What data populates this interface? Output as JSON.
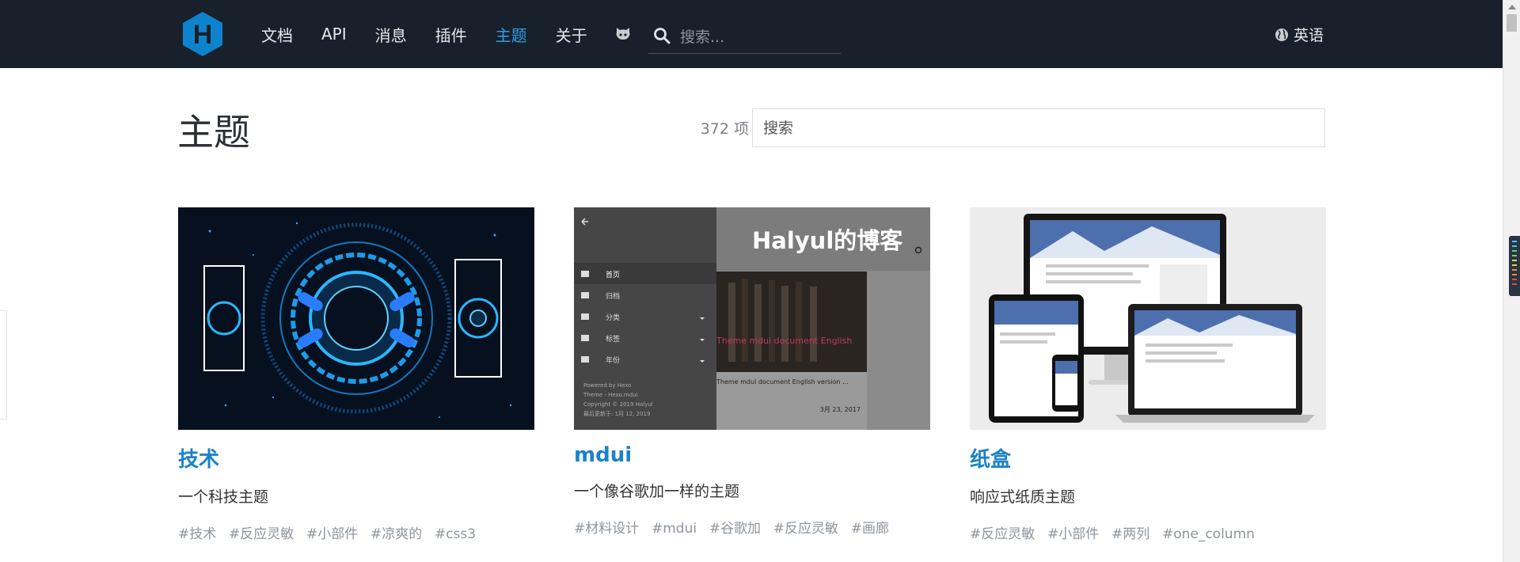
{
  "header": {
    "nav": [
      "文档",
      "API",
      "消息",
      "插件",
      "主题",
      "关于"
    ],
    "active_index": 4,
    "search_placeholder": "搜索...",
    "language_label": "英语",
    "logo_letter": "H",
    "brand_color": "#0e83cd"
  },
  "page": {
    "title": "主题",
    "count_label": "372 项",
    "search_placeholder": "搜索"
  },
  "cards": [
    {
      "name": "技术",
      "description": "一个科技主题",
      "tags": [
        "#技术",
        "#反应灵敏",
        "#小部件",
        "#凉爽的",
        "#css3"
      ]
    },
    {
      "name": "mdui",
      "description": "一个像谷歌加一样的主题",
      "tags": [
        "#材料设计",
        "#mdui",
        "#谷歌加",
        "#反应灵敏",
        "#画廊"
      ],
      "thumb": {
        "blog_title": "Halyul的博客",
        "menu": [
          "首页",
          "归档",
          "分类",
          "标签",
          "年份"
        ],
        "footer": [
          "Powered by Hexo",
          "Theme - Hexo.mdui",
          "Copyright © 2019 Halyul",
          "最后更新于: 1月 12, 2019"
        ],
        "post_title": "Theme mdui document English",
        "post_excerpt": "Theme mdui document English version ...",
        "post_date": "3月 23, 2017"
      }
    },
    {
      "name": "纸盒",
      "description": "响应式纸质主题",
      "tags": [
        "#反应灵敏",
        "#小部件",
        "#两列",
        "#one_column"
      ]
    }
  ],
  "colors": {
    "header_bg": "#17202b",
    "nav_active": "#2d9fe8",
    "card_title": "#1b82c9",
    "tag": "#8e959c"
  }
}
